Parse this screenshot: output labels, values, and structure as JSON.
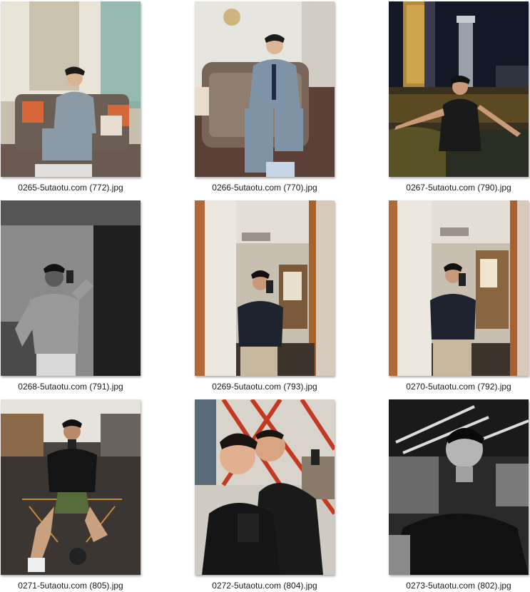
{
  "files": [
    {
      "name": "0265-5utaotu.com (772).jpg",
      "thumbnail": "man-in-grey-suit-on-sofa-photo"
    },
    {
      "name": "0266-5utaotu.com (770).jpg",
      "thumbnail": "man-in-blue-suit-seated-photo"
    },
    {
      "name": "0267-5utaotu.com (790).jpg",
      "thumbnail": "man-at-night-riverside-photo"
    },
    {
      "name": "0268-5utaotu.com (791).jpg",
      "thumbnail": "black-and-white-mirror-selfie-photo"
    },
    {
      "name": "0269-5utaotu.com (793).jpg",
      "thumbnail": "mirror-selfie-black-shirt-photo"
    },
    {
      "name": "0270-5utaotu.com (792).jpg",
      "thumbnail": "mirror-selfie-black-shirt-photo"
    },
    {
      "name": "0271-5utaotu.com (805).jpg",
      "thumbnail": "gym-selfie-photo"
    },
    {
      "name": "0272-5utaotu.com (804).jpg",
      "thumbnail": "gym-mirror-selfie-photo"
    },
    {
      "name": "0273-5utaotu.com (802).jpg",
      "thumbnail": "black-and-white-gym-selfie-photo"
    }
  ]
}
